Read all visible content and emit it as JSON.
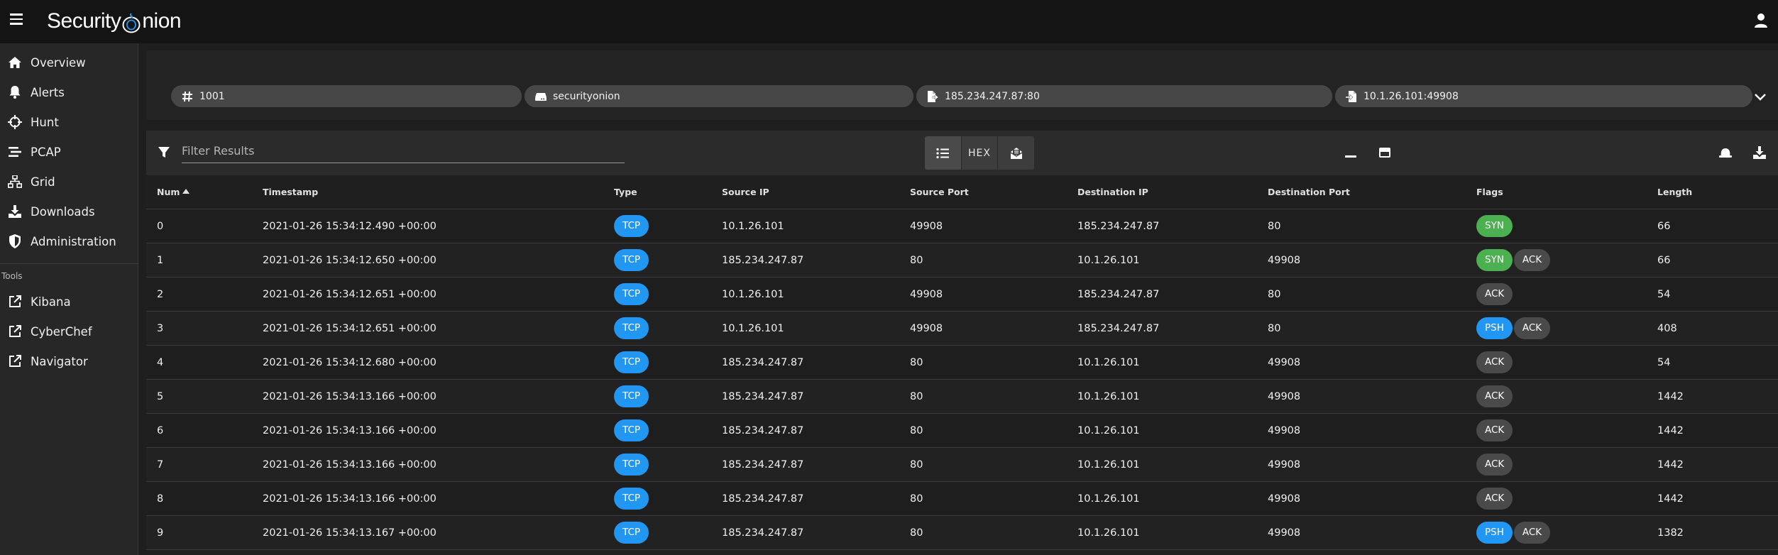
{
  "app": {
    "brand_prefix": "Security",
    "brand_suffix": "nion"
  },
  "sidebar": {
    "items": [
      {
        "label": "Overview",
        "icon": "home-icon"
      },
      {
        "label": "Alerts",
        "icon": "bell-icon"
      },
      {
        "label": "Hunt",
        "icon": "crosshairs-icon"
      },
      {
        "label": "PCAP",
        "icon": "stream-icon"
      },
      {
        "label": "Grid",
        "icon": "sitemap-icon"
      },
      {
        "label": "Downloads",
        "icon": "download-icon"
      },
      {
        "label": "Administration",
        "icon": "shield-icon"
      }
    ],
    "tools_header": "Tools",
    "tools": [
      {
        "label": "Kibana",
        "icon": "external-link-icon"
      },
      {
        "label": "CyberChef",
        "icon": "external-link-icon"
      },
      {
        "label": "Navigator",
        "icon": "external-link-icon"
      }
    ]
  },
  "chips": {
    "job_id": "1001",
    "sensor": "securityonion",
    "source": "185.234.247.87:80",
    "destination": "10.1.26.101:49908"
  },
  "toolbar": {
    "filter_placeholder": "Filter Results",
    "hex_label": "HEX"
  },
  "table": {
    "headers": {
      "num": "Num",
      "timestamp": "Timestamp",
      "type": "Type",
      "source_ip": "Source IP",
      "source_port": "Source Port",
      "destination_ip": "Destination IP",
      "destination_port": "Destination Port",
      "flags": "Flags",
      "length": "Length"
    },
    "rows": [
      {
        "num": "0",
        "timestamp": "2021-01-26 15:34:12.490 +00:00",
        "type": "TCP",
        "source_ip": "10.1.26.101",
        "source_port": "49908",
        "destination_ip": "185.234.247.87",
        "destination_port": "80",
        "flags": [
          "SYN"
        ],
        "length": "66"
      },
      {
        "num": "1",
        "timestamp": "2021-01-26 15:34:12.650 +00:00",
        "type": "TCP",
        "source_ip": "185.234.247.87",
        "source_port": "80",
        "destination_ip": "10.1.26.101",
        "destination_port": "49908",
        "flags": [
          "SYN",
          "ACK"
        ],
        "length": "66"
      },
      {
        "num": "2",
        "timestamp": "2021-01-26 15:34:12.651 +00:00",
        "type": "TCP",
        "source_ip": "10.1.26.101",
        "source_port": "49908",
        "destination_ip": "185.234.247.87",
        "destination_port": "80",
        "flags": [
          "ACK"
        ],
        "length": "54"
      },
      {
        "num": "3",
        "timestamp": "2021-01-26 15:34:12.651 +00:00",
        "type": "TCP",
        "source_ip": "10.1.26.101",
        "source_port": "49908",
        "destination_ip": "185.234.247.87",
        "destination_port": "80",
        "flags": [
          "PSH",
          "ACK"
        ],
        "length": "408"
      },
      {
        "num": "4",
        "timestamp": "2021-01-26 15:34:12.680 +00:00",
        "type": "TCP",
        "source_ip": "185.234.247.87",
        "source_port": "80",
        "destination_ip": "10.1.26.101",
        "destination_port": "49908",
        "flags": [
          "ACK"
        ],
        "length": "54"
      },
      {
        "num": "5",
        "timestamp": "2021-01-26 15:34:13.166 +00:00",
        "type": "TCP",
        "source_ip": "185.234.247.87",
        "source_port": "80",
        "destination_ip": "10.1.26.101",
        "destination_port": "49908",
        "flags": [
          "ACK"
        ],
        "length": "1442"
      },
      {
        "num": "6",
        "timestamp": "2021-01-26 15:34:13.166 +00:00",
        "type": "TCP",
        "source_ip": "185.234.247.87",
        "source_port": "80",
        "destination_ip": "10.1.26.101",
        "destination_port": "49908",
        "flags": [
          "ACK"
        ],
        "length": "1442"
      },
      {
        "num": "7",
        "timestamp": "2021-01-26 15:34:13.166 +00:00",
        "type": "TCP",
        "source_ip": "185.234.247.87",
        "source_port": "80",
        "destination_ip": "10.1.26.101",
        "destination_port": "49908",
        "flags": [
          "ACK"
        ],
        "length": "1442"
      },
      {
        "num": "8",
        "timestamp": "2021-01-26 15:34:13.166 +00:00",
        "type": "TCP",
        "source_ip": "185.234.247.87",
        "source_port": "80",
        "destination_ip": "10.1.26.101",
        "destination_port": "49908",
        "flags": [
          "ACK"
        ],
        "length": "1442"
      },
      {
        "num": "9",
        "timestamp": "2021-01-26 15:34:13.167 +00:00",
        "type": "TCP",
        "source_ip": "185.234.247.87",
        "source_port": "80",
        "destination_ip": "10.1.26.101",
        "destination_port": "49908",
        "flags": [
          "PSH",
          "ACK"
        ],
        "length": "1382"
      }
    ]
  },
  "colors": {
    "accent_blue": "#2196f3",
    "syn_green": "#4caf50",
    "ack_grey": "#4a4a4a",
    "background": "#1e1e1e",
    "sidebar": "#272727",
    "topbar": "#141414"
  }
}
